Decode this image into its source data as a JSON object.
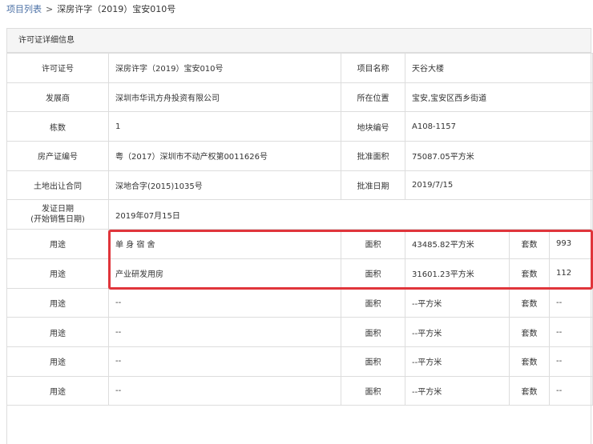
{
  "breadcrumb": {
    "link": "项目列表",
    "separator": ">",
    "current": "深房许字（2019）宝安010号"
  },
  "panel": {
    "title": "许可证详细信息"
  },
  "info_rows": [
    {
      "l1": "许可证号",
      "v1": "深房许字（2019）宝安010号",
      "l2": "项目名称",
      "v2": "天谷大楼"
    },
    {
      "l1": "发展商",
      "v1": "深圳市华讯方舟投资有限公司",
      "l2": "所在位置",
      "v2": "宝安,宝安区西乡街道"
    },
    {
      "l1": "栋数",
      "v1": "1",
      "l2": "地块编号",
      "v2": "A108-1157"
    },
    {
      "l1": "房产证编号",
      "v1": "粤（2017）深圳市不动产权第0011626号",
      "l2": "批准面积",
      "v2": "75087.05平方米"
    },
    {
      "l1": "土地出让合同",
      "v1": "深地合字(2015)1035号",
      "l2": "批准日期",
      "v2": "2019/7/15"
    }
  ],
  "issue_date": {
    "label_line1": "发证日期",
    "label_line2": "(开始销售日期)",
    "value": "2019年07月15日"
  },
  "usage_rows": [
    {
      "label": "用途",
      "use": "单 身 宿 舍",
      "area_label": "面积",
      "area": "43485.82平方米",
      "count_label": "套数",
      "count": "993"
    },
    {
      "label": "用途",
      "use": "产业研发用房",
      "area_label": "面积",
      "area": "31601.23平方米",
      "count_label": "套数",
      "count": "112"
    },
    {
      "label": "用途",
      "use": "--",
      "area_label": "面积",
      "area": "--平方米",
      "count_label": "套数",
      "count": "--"
    },
    {
      "label": "用途",
      "use": "--",
      "area_label": "面积",
      "area": "--平方米",
      "count_label": "套数",
      "count": "--"
    },
    {
      "label": "用途",
      "use": "--",
      "area_label": "面积",
      "area": "--平方米",
      "count_label": "套数",
      "count": "--"
    },
    {
      "label": "用途",
      "use": "--",
      "area_label": "面积",
      "area": "--平方米",
      "count_label": "套数",
      "count": "--"
    }
  ],
  "colors": {
    "highlight": "#e0353b",
    "link": "#4a6fa5",
    "border": "#dddddd",
    "header_bg": "#f5f5f5"
  }
}
